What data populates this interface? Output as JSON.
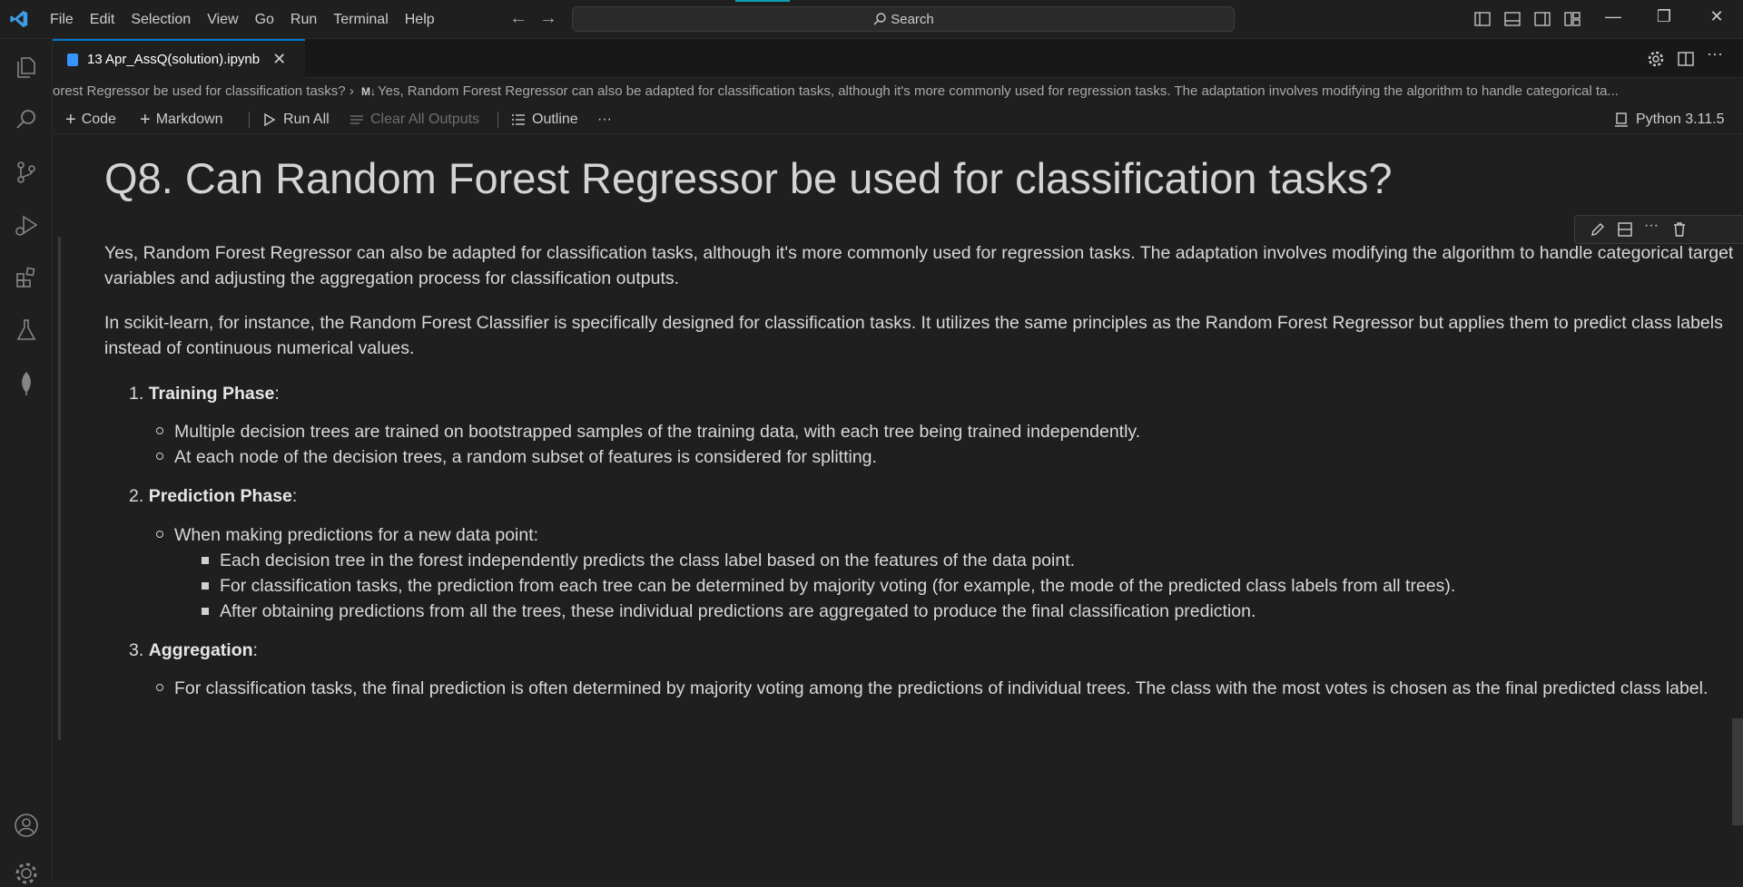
{
  "app": {
    "menu": [
      "File",
      "Edit",
      "Selection",
      "View",
      "Go",
      "Run",
      "Terminal",
      "Help"
    ],
    "search_label": "Search",
    "accent_color": "#0078d4"
  },
  "tab": {
    "title": "13 Apr_AssQ(solution).ipynb",
    "close_glyph": "✕"
  },
  "breadcrumb": {
    "part1": "orest Regressor be used for classification tasks?",
    "md_badge": "M↓",
    "part2": "Yes, Random Forest Regressor can also be adapted for classification tasks, although it's more commonly used for regression tasks. The adaptation involves modifying the algorithm to handle categorical ta..."
  },
  "toolbar": {
    "code_label": "Code",
    "markdown_label": "Markdown",
    "run_all_label": "Run All",
    "clear_outputs_label": "Clear All Outputs",
    "outline_label": "Outline",
    "more_label": "···",
    "kernel_label": "Python 3.11.5"
  },
  "cell": {
    "heading": "Q8. Can Random Forest Regressor be used for classification tasks?",
    "para1": "Yes, Random Forest Regressor can also be adapted for classification tasks, although it's more commonly used for regression tasks. The adaptation involves modifying the algorithm to handle categorical target variables and adjusting the aggregation process for classification outputs.",
    "para2": "In scikit-learn, for instance, the Random Forest Classifier is specifically designed for classification tasks. It utilizes the same principles as the Random Forest Regressor but applies them to predict class labels instead of continuous numerical values.",
    "steps": [
      {
        "num": "1.",
        "title": "Training Phase",
        "items": [
          "Multiple decision trees are trained on bootstrapped samples of the training data, with each tree being trained independently.",
          "At each node of the decision trees, a random subset of features is considered for splitting."
        ]
      },
      {
        "num": "2.",
        "title": "Prediction Phase",
        "items": [
          "When making predictions for a new data point:"
        ],
        "subitems": [
          "Each decision tree in the forest independently predicts the class label based on the features of the data point.",
          "For classification tasks, the prediction from each tree can be determined by majority voting (for example, the mode of the predicted class labels from all trees).",
          "After obtaining predictions from all the trees, these individual predictions are aggregated to produce the final classification prediction."
        ]
      },
      {
        "num": "3.",
        "title": "Aggregation",
        "items": [
          "For classification tasks, the final prediction is often determined by majority voting among the predictions of individual trees. The class with the most votes is chosen as the final predicted class label."
        ]
      }
    ]
  }
}
